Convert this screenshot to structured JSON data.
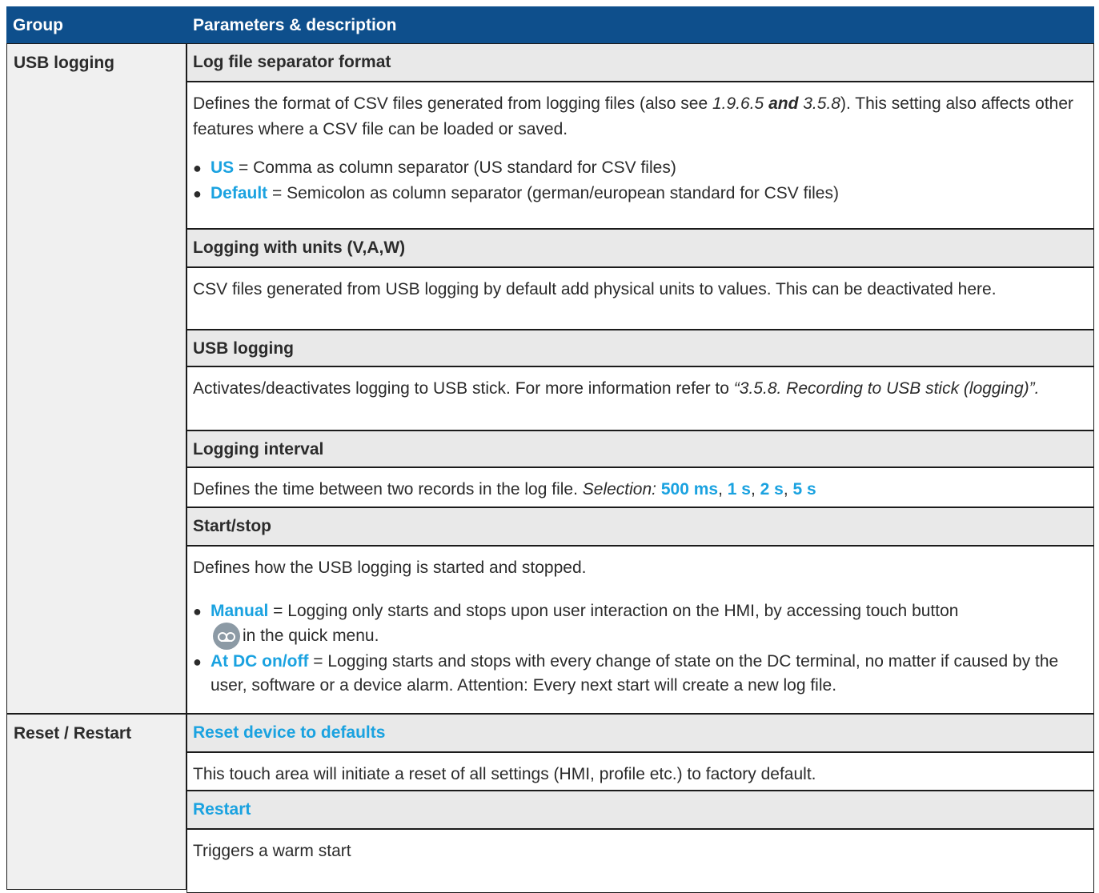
{
  "header": {
    "group": "Group",
    "params": "Parameters & description"
  },
  "usb": {
    "group": "USB logging",
    "sep_title": "Log file separator format",
    "sep_desc_a": "Defines the format of CSV files generated from logging files (also see ",
    "sep_desc_ref1": "1.9.6.5",
    "sep_desc_and": " and ",
    "sep_desc_ref2": "3.5.8",
    "sep_desc_b": "). This setting also affects other features where a CSV file can be loaded or saved.",
    "sep_us_kw": "US",
    "sep_us_text": " = Comma as column separator (US standard for CSV files)",
    "sep_def_kw": "Default",
    "sep_def_text": " = Semicolon as column separator (german/european standard for CSV files)",
    "units_title": "Logging with units (V,A,W)",
    "units_desc": "CSV files generated from USB logging by default add physical units to values. This can be deactivated here.",
    "log_title": "USB logging",
    "log_desc_a": "Activates/deactivates logging to USB stick. For more information refer to ",
    "log_desc_ref": "“3.5.8. Recording to USB stick (logging)”.",
    "int_title": "Logging interval",
    "int_desc": "Defines the time between two records in the log file. ",
    "int_sel": "Selection:",
    "int_opts": [
      "500 ms",
      "1 s",
      "2 s",
      "5 s"
    ],
    "int_sep": ", ",
    "ss_title": "Start/stop",
    "ss_desc": "Defines how the USB logging is started and stopped.",
    "ss_manual_kw": "Manual",
    "ss_manual_text": " = Logging only starts and stops upon user interaction on the HMI, by accessing touch button",
    "ss_manual_text2": "in the quick menu.",
    "ss_dc_kw": "At DC on/off",
    "ss_dc_text": " = Logging starts and stops with every change of state on the DC terminal, no matter if caused by the user, software or a device alarm. Attention: Every next start will create a new log file."
  },
  "reset": {
    "group": "Reset / Restart",
    "reset_title": "Reset device to defaults",
    "reset_desc": "This touch area will initiate a reset of all settings (HMI, profile etc.) to factory default.",
    "restart_title": "Restart",
    "restart_desc": "Triggers a warm start"
  },
  "icons": {
    "logging_button": "record-icon"
  },
  "colors": {
    "header_bg": "#0e4f8c",
    "keyword": "#1aa2e0"
  }
}
